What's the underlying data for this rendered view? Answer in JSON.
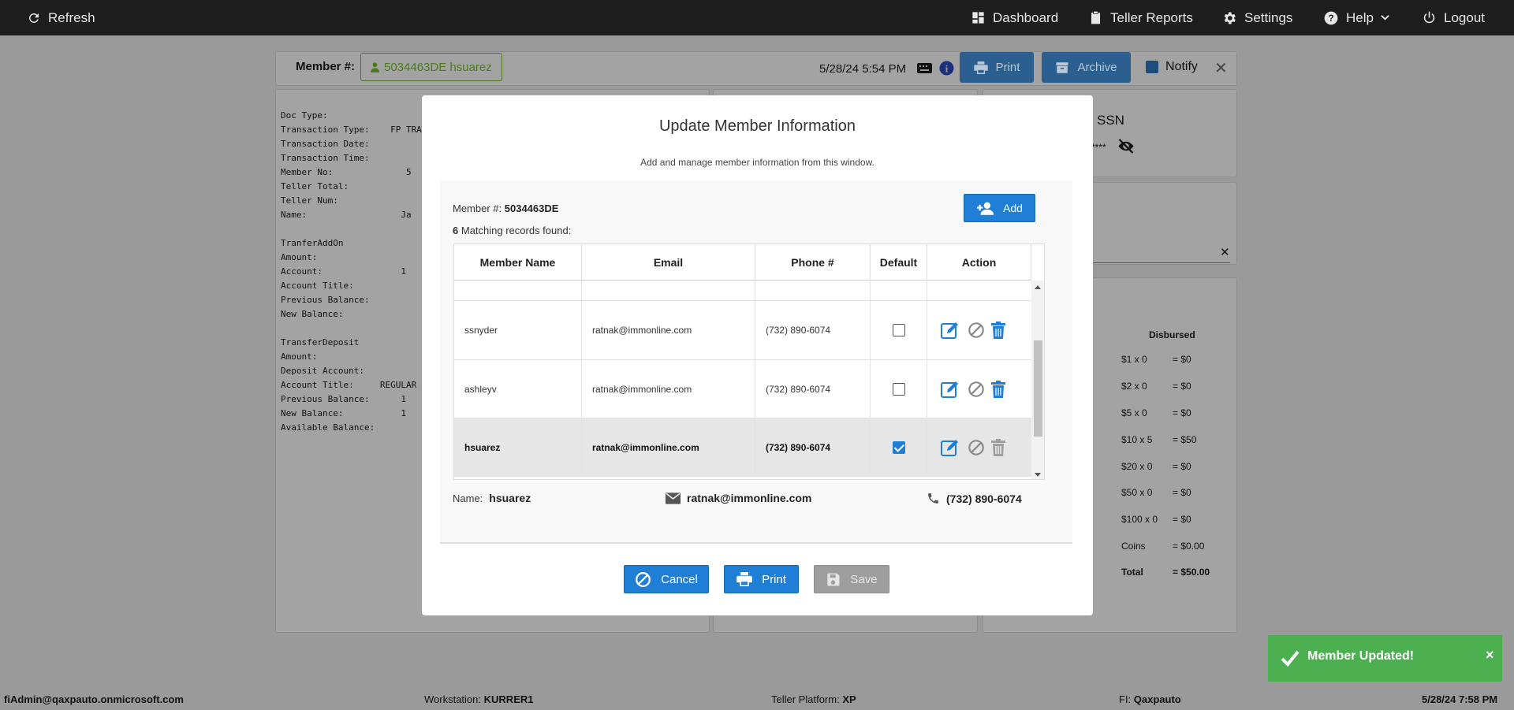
{
  "topbar": {
    "refresh_label": "Refresh",
    "dashboard_label": "Dashboard",
    "teller_reports_label": "Teller Reports",
    "settings_label": "Settings",
    "help_label": "Help",
    "logout_label": "Logout"
  },
  "background": {
    "member_label": "Member #:",
    "member_chip": "5034463DE hsuarez",
    "datetime": "5/28/24 5:54 PM",
    "print_label": "Print",
    "archive_label": "Archive",
    "notify_label": "Notify",
    "receipt_text": "Doc Type:\nTransaction Type:    FP TRA\nTransaction Date:\nTransaction Time:\nMember No:              5\nTeller Total:\nTeller Num:\nName:                  Ja\n\nTranferAddOn\nAmount:\nAccount:               1\nAccount Title:\nPrevious Balance:\nNew Balance:\n\nTransferDeposit\nAmount:\nDeposit Account:\nAccount Title:     REGULAR\nPrevious Balance:      1\nNew Balance:           1\nAvailable Balance:",
    "ssn_label": "SSN",
    "ssn_masked": "****",
    "disbursed_header": "Disbursed",
    "disbursed_rows": [
      {
        "denom": "$1 x 0",
        "amount": "= $0"
      },
      {
        "denom": "$2 x 0",
        "amount": "= $0"
      },
      {
        "denom": "$5 x 0",
        "amount": "= $0"
      },
      {
        "denom": "$10 x 5",
        "amount": "= $50"
      },
      {
        "denom": "$20 x 0",
        "amount": "= $0"
      },
      {
        "denom": "$50 x 0",
        "amount": "= $0"
      },
      {
        "denom": "$100 x 0",
        "amount": "= $0"
      },
      {
        "denom": "Coins",
        "amount": "= $0.00"
      },
      {
        "denom": "Total",
        "amount": "= $50.00"
      }
    ]
  },
  "modal": {
    "title": "Update Member Information",
    "subtitle": "Add and manage member information from this window.",
    "member_label": "Member #:",
    "member_number": "5034463DE",
    "match_count": "6",
    "match_text": "Matching records found:",
    "add_label": "Add",
    "columns": [
      "Member Name",
      "Email",
      "Phone #",
      "Default",
      "Action"
    ],
    "rows": [
      {
        "name": "ssnyder",
        "email": "ratnak@immonline.com",
        "phone": "(732) 890-6074",
        "default": false
      },
      {
        "name": "ashleyv",
        "email": "ratnak@immonline.com",
        "phone": "(732) 890-6074",
        "default": false
      },
      {
        "name": "hsuarez",
        "email": "ratnak@immonline.com",
        "phone": "(732) 890-6074",
        "default": true
      }
    ],
    "summary": {
      "name_label": "Name:",
      "name_value": "hsuarez",
      "email_value": "ratnak@immonline.com",
      "phone_value": "(732) 890-6074"
    },
    "cancel_label": "Cancel",
    "print_label": "Print",
    "save_label": "Save"
  },
  "toast": {
    "message": "Member Updated!",
    "close": "×"
  },
  "footer": {
    "user": "fiAdmin@qaxpauto.onmicrosoft.com",
    "workstation_label": "Workstation:",
    "workstation_value": "KURRER1",
    "platform_label": "Teller Platform:",
    "platform_value": "XP",
    "fi_label": "FI:",
    "fi_value": "Qaxpauto",
    "datetime": "5/28/24 7:58 PM"
  },
  "colors": {
    "primary": "#1f7fd6",
    "success": "#4caf50",
    "topbar": "#1e1e1e",
    "disabled": "#9e9e9e"
  }
}
